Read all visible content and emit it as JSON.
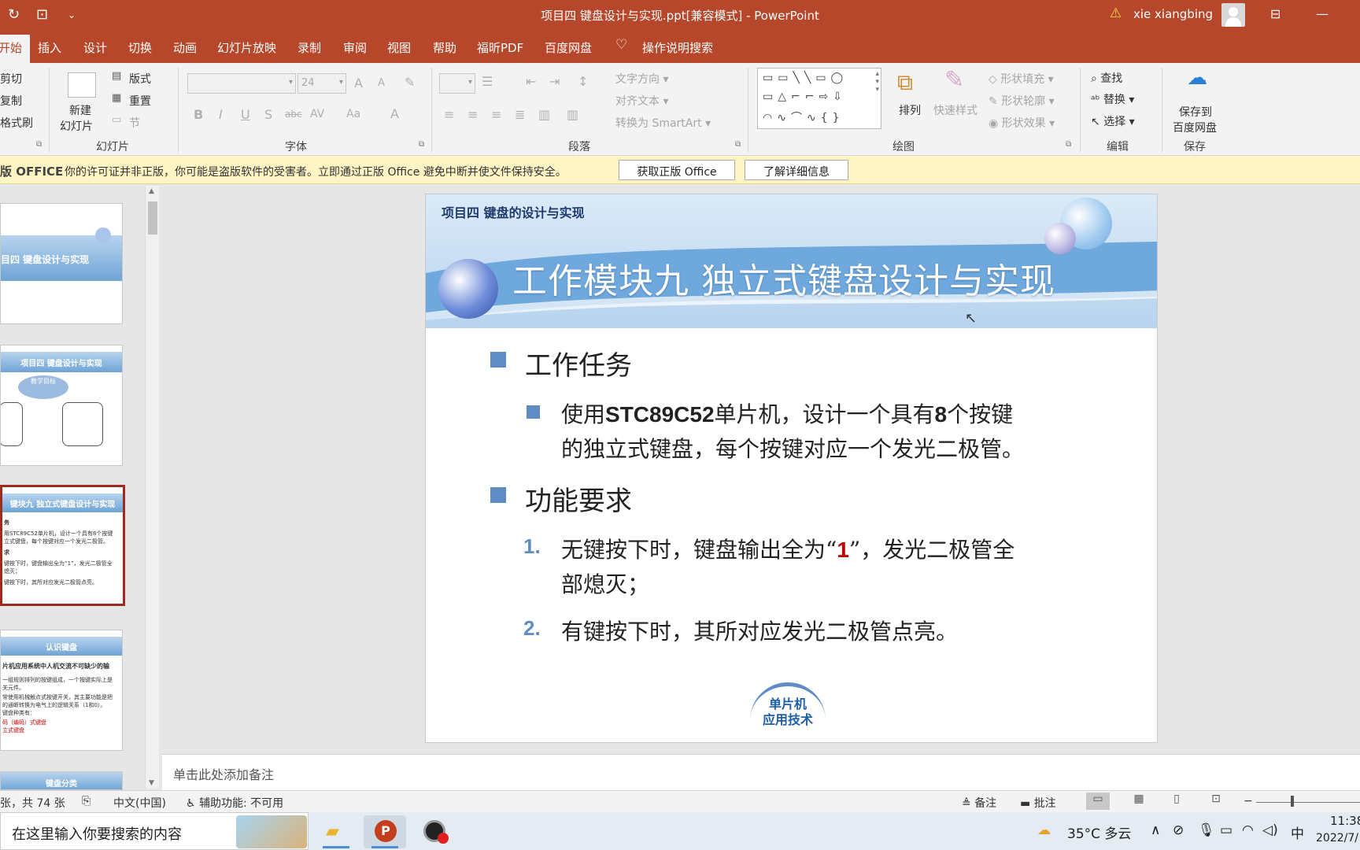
{
  "window": {
    "title": "项目四 键盘设计与实现.ppt[兼容模式] - PowerPoint",
    "user": "xie xiangbing",
    "qa_icons": [
      "↻",
      "🖵",
      "⌄"
    ]
  },
  "tabs": [
    "开始",
    "插入",
    "设计",
    "切换",
    "动画",
    "幻灯片放映",
    "录制",
    "审阅",
    "视图",
    "帮助",
    "福昕PDF",
    "百度网盘"
  ],
  "tell_me": "操作说明搜索",
  "ribbon": {
    "clipboard": {
      "cut": "剪切",
      "copy": "复制",
      "painter": "格式刷"
    },
    "slides": {
      "new_slide": "新建",
      "new_slide2": "幻灯片",
      "layout": "版式",
      "reset": "重置",
      "section": "节",
      "group": "幻灯片"
    },
    "font": {
      "size": "24",
      "group": "字体",
      "bold": "B",
      "italic": "I",
      "underline": "U",
      "shadow": "S",
      "strike": "abc",
      "spacing": "AV",
      "case": "Aa",
      "color": "A",
      "grow": "A",
      "shrink": "A"
    },
    "paragraph": {
      "text_dir": "文字方向",
      "align_text": "对齐文本",
      "smartart": "转换为 SmartArt",
      "group": "段落"
    },
    "drawing": {
      "arrange": "排列",
      "quick_styles": "快速样式",
      "fill": "形状填充",
      "outline": "形状轮廓",
      "effects": "形状效果",
      "group": "绘图"
    },
    "editing": {
      "find": "查找",
      "replace": "替换",
      "select": "选择",
      "group": "编辑"
    },
    "save": {
      "line1": "保存到",
      "line2": "百度网盘",
      "group": "保存"
    }
  },
  "notification": {
    "brand": "版 OFFICE",
    "message": "你的许可证并非正版，你可能是盗版软件的受害者。立即通过正版 Office 避免中断并使文件保持安全。",
    "btn_genuine": "获取正版 Office",
    "btn_learn": "了解详细信息"
  },
  "thumbnails": [
    {
      "title": "目四  键盘设计与实现"
    },
    {
      "title": "项目四 键盘设计与实现",
      "sub": "教学目标"
    },
    {
      "title": "键块九  独立式键盘设计与实现",
      "lines": [
        "务",
        "用STC89C52单片机，设计一个具有8个按键",
        "立式键盘，每个按键对应一个发光二极管。",
        "求",
        "键按下时，键盘输出全为“1”，发光二极管全",
        "熄灭；",
        "键按下时，其所对应发光二极管点亮。"
      ]
    },
    {
      "title": "认识键盘",
      "lines": [
        "片机应用系统中人机交流不可缺少的输",
        "一组规则排列的按键组成，一个按键实际上是",
        "关元件。",
        "常使用机械触点式按键开关，其主要功能是把",
        "的通断转换为电气上的逻辑关系（1和0）。",
        "键盘种类有：",
        "码（编码）式键盘",
        "立式键盘"
      ]
    },
    {
      "title": "键盘分类"
    }
  ],
  "slide": {
    "project_label": "项目四  键盘的设计与实现",
    "title": "工作模块九  独立式键盘设计与实现",
    "section1": "工作任务",
    "task_pre": "使用",
    "task_chip": "STC89C52",
    "task_mid": "单片机，设计一个具有",
    "task_num": "8",
    "task_post": "个按键",
    "task_line2": "的独立式键盘，每个按键对应一个发光二极管。",
    "section2": "功能要求",
    "item1_num": "1.",
    "item1_pre": "无键按下时，键盘输出全为“",
    "item1_val": "1",
    "item1_post": "”，发光二极管全",
    "item1_line2": "部熄灭；",
    "item2_num": "2.",
    "item2": "有键按下时，其所对应发光二极管点亮。",
    "logo_line1": "单片机",
    "logo_line2": "应用技术"
  },
  "notes_placeholder": "单击此处添加备注",
  "status": {
    "slide_count": "张，共 74 张",
    "language": "中文(中国)",
    "accessibility": "辅助功能: 不可用",
    "notes": "备注",
    "comments": "批注"
  },
  "taskbar": {
    "search_placeholder": "在这里输入你要搜索的内容",
    "weather": "35°C  多云",
    "ime": "中",
    "time": "11:38",
    "date": "2022/7/"
  },
  "colors": {
    "accent": "#b7472a",
    "bullet": "#5f8cc4",
    "highlight": "#c00000"
  }
}
